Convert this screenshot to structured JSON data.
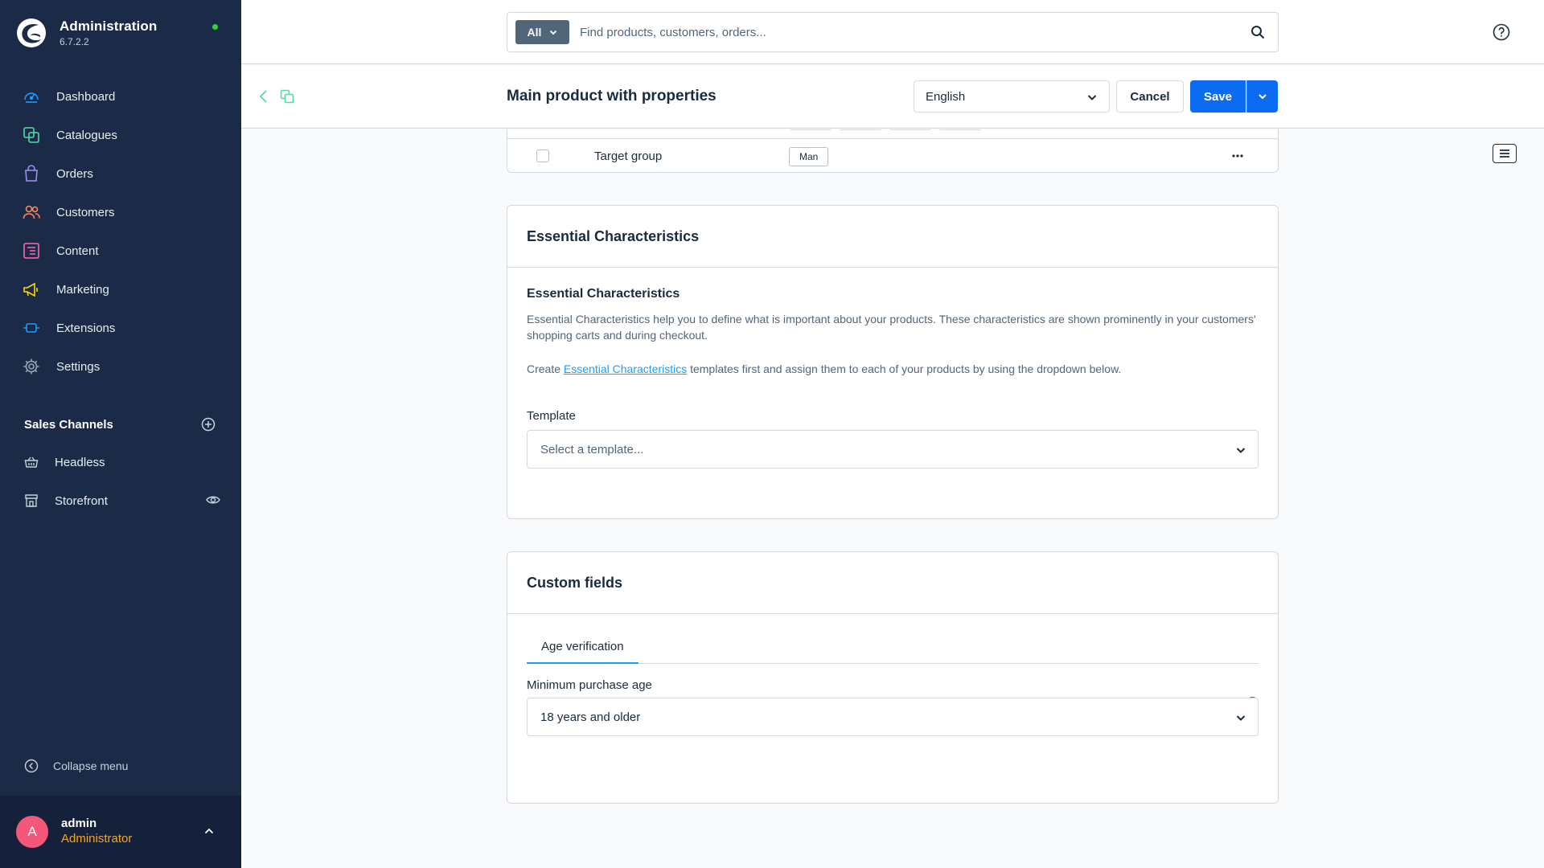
{
  "app": {
    "name": "Administration",
    "version": "6.7.2.2"
  },
  "sidebar": {
    "items": [
      {
        "label": "Dashboard",
        "icon": "dashboard-icon",
        "color": "#189eff"
      },
      {
        "label": "Catalogues",
        "icon": "catalogue-icon",
        "color": "#57d9a3"
      },
      {
        "label": "Orders",
        "icon": "orders-icon",
        "color": "#a092f0"
      },
      {
        "label": "Customers",
        "icon": "customers-icon",
        "color": "#f88962"
      },
      {
        "label": "Content",
        "icon": "content-icon",
        "color": "#ff68b4"
      },
      {
        "label": "Marketing",
        "icon": "marketing-icon",
        "color": "#ffd700"
      },
      {
        "label": "Extensions",
        "icon": "extensions-icon",
        "color": "#189eff"
      },
      {
        "label": "Settings",
        "icon": "settings-icon",
        "color": "#9aa8b5"
      }
    ],
    "sales_channels": {
      "title": "Sales Channels",
      "items": [
        {
          "label": "Headless",
          "icon": "basket-icon"
        },
        {
          "label": "Storefront",
          "icon": "storefront-icon"
        }
      ]
    },
    "collapse_label": "Collapse menu",
    "user": {
      "initial": "A",
      "name": "admin",
      "role": "Administrator"
    }
  },
  "topbar": {
    "search_filter": "All",
    "search_placeholder": "Find products, customers, orders..."
  },
  "smartbar": {
    "title": "Main product with properties",
    "language": "English",
    "cancel_label": "Cancel",
    "save_label": "Save"
  },
  "properties": {
    "row": {
      "name": "Target group",
      "value": "Man"
    }
  },
  "essential_characteristics": {
    "card_title": "Essential Characteristics",
    "subtitle": "Essential Characteristics",
    "description": "Essential Characteristics help you to define what is important about your products. These characteristics are shown prominently in your customers' shopping carts and during checkout.",
    "create_prefix": "Create",
    "create_link": "Essential Characteristics",
    "create_suffix": "templates first and assign them to each of your products by using the dropdown below.",
    "template_label": "Template",
    "template_placeholder": "Select a template..."
  },
  "custom_fields": {
    "card_title": "Custom fields",
    "tab": "Age verification",
    "field_label": "Minimum purchase age",
    "field_value": "18 years and older",
    "help_symbol": "?"
  }
}
